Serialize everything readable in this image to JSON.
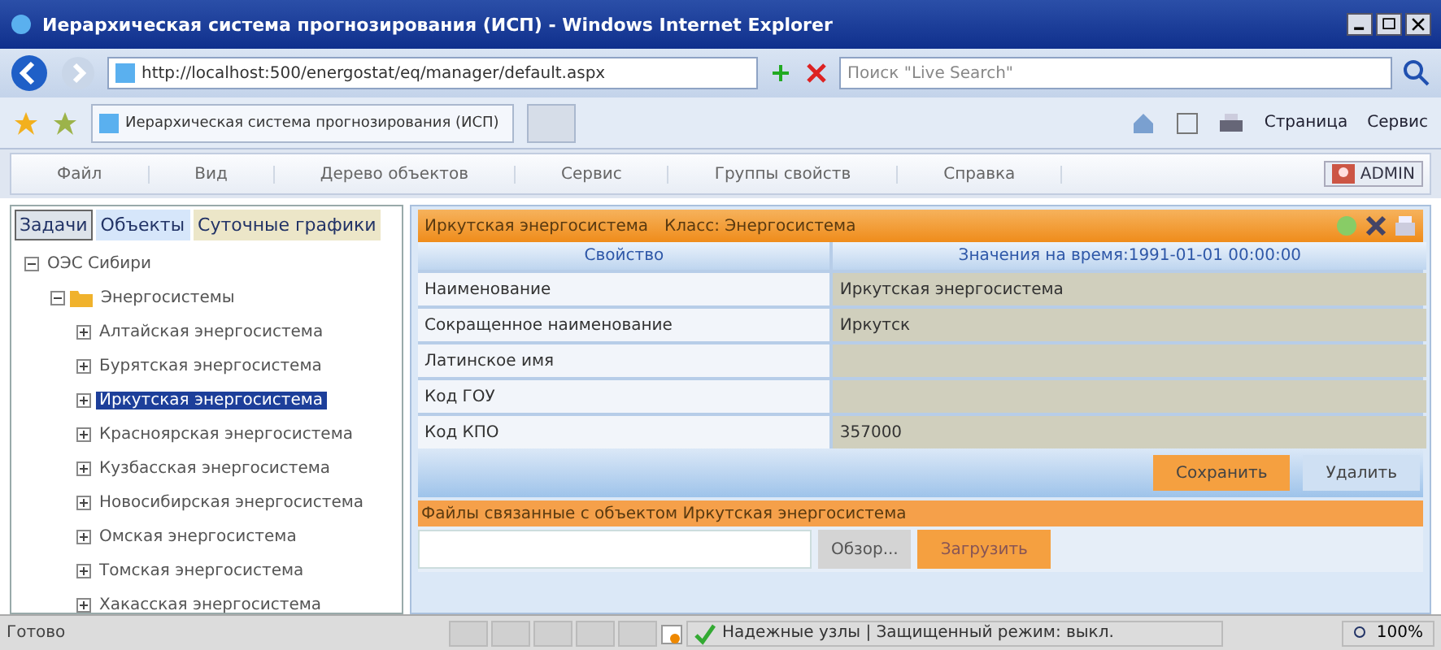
{
  "window": {
    "title": "Иерархическая система прогнозирования (ИСП) - Windows Internet Explorer"
  },
  "address_bar": {
    "url": "http://localhost:500/energostat/eq/manager/default.aspx",
    "search_placeholder": "Поиск \"Live Search\""
  },
  "browser_tab": {
    "title": "Иерархическая система прогнозирования (ИСП)"
  },
  "command_bar": [
    "Страница",
    "Сервис"
  ],
  "menu": [
    "Файл",
    "Вид",
    "Дерево объектов",
    "Сервис",
    "Группы свойств",
    "Справка"
  ],
  "user": "ADMIN",
  "left_tabs": [
    {
      "label": "Задачи",
      "selected": true
    },
    {
      "label": "Объекты",
      "selected": false
    },
    {
      "label": "Суточные графики",
      "selected": false
    }
  ],
  "tree": [
    {
      "label": "ОЭС Сибири",
      "expanded": true,
      "selected": false,
      "children": [
        {
          "label": "Энергосистемы",
          "folder": true,
          "expanded": true,
          "selected": false,
          "children": [
            {
              "label": "Алтайская энергосистема",
              "expanded": false,
              "selected": false
            },
            {
              "label": "Бурятская энергосистема",
              "expanded": false,
              "selected": false
            },
            {
              "label": "Иркутская энергосистема",
              "expanded": false,
              "selected": true
            },
            {
              "label": "Красноярская энергосистема",
              "expanded": false,
              "selected": false
            },
            {
              "label": "Кузбасская энергосистема",
              "expanded": false,
              "selected": false
            },
            {
              "label": "Новосибирская энергосистема",
              "expanded": false,
              "selected": false
            },
            {
              "label": "Омская энергосистема",
              "expanded": false,
              "selected": false
            },
            {
              "label": "Томская энергосистема",
              "expanded": false,
              "selected": false
            },
            {
              "label": "Хакасская энергосистема",
              "expanded": false,
              "selected": false
            }
          ]
        }
      ]
    }
  ],
  "object_header": {
    "name": "Иркутская энергосистема",
    "class": "Класс: Энергосистема"
  },
  "properties": {
    "columns": [
      "Свойство",
      "Значения на время:1991-01-01 00:00:00"
    ],
    "rows": [
      {
        "name": "Наименование",
        "value": "Иркутская энергосистема"
      },
      {
        "name": "Сокращенное наименование",
        "value": "Иркутск"
      },
      {
        "name": "Латинское имя"
      },
      {
        "name": "Код ГОУ"
      },
      {
        "name": "Код КПО",
        "value": "357000"
      }
    ]
  },
  "buttons": [
    "Сохранить",
    "Удалить"
  ],
  "files": {
    "title": "Файлы связанные с объектом Иркутская энергосистема",
    "browse": "Обзор...",
    "upload": "Загрузить"
  },
  "status_bar": {
    "text": "Готово",
    "zone": "Надежные узлы | Защищенный режим: выкл.",
    "zoom": "100%"
  }
}
